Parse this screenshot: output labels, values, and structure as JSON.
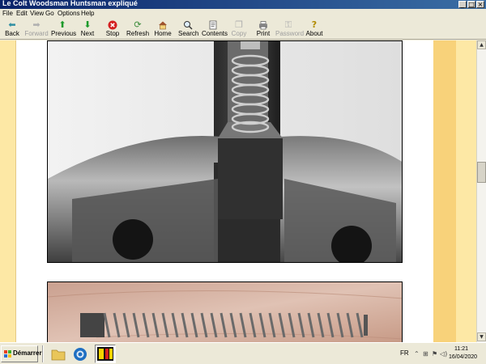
{
  "window": {
    "title": "Le Colt Woodsman Huntsman expliqué"
  },
  "menu": [
    "File",
    "Edit",
    "View",
    "Go",
    "Options",
    "Help"
  ],
  "toolbar": {
    "back": "Back",
    "forward": "Forward",
    "previous": "Previous",
    "next": "Next",
    "stop": "Stop",
    "refresh": "Refresh",
    "home": "Home",
    "search": "Search",
    "contents": "Contents",
    "copy": "Copy",
    "print": "Print",
    "password": "Password",
    "about": "About"
  },
  "icons": {
    "back": "left-arrow-icon",
    "forward": "right-arrow-icon",
    "previous": "up-arrow-icon",
    "next": "down-arrow-icon",
    "stop": "stop-icon",
    "refresh": "refresh-icon",
    "home": "home-icon",
    "search": "search-icon",
    "contents": "contents-icon",
    "copy": "copy-icon",
    "print": "printer-icon",
    "password": "key-icon",
    "about": "help-icon"
  },
  "colors": {
    "titlebar_start": "#0a246a",
    "titlebar_end": "#3a6ea5",
    "page_side_light": "#fde8a5",
    "page_side_dark": "#f8d27a"
  },
  "taskbar": {
    "start_label": "Démarrer",
    "language": "FR",
    "time": "11:21",
    "date": "16/04/2020"
  }
}
